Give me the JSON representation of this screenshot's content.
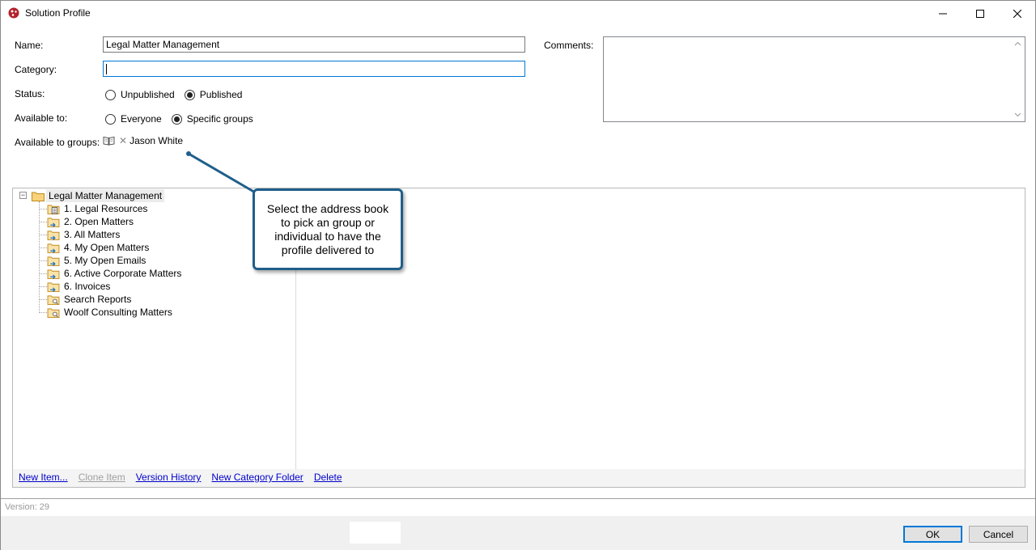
{
  "window": {
    "title": "Solution Profile",
    "icons": [
      "app-logo-icon",
      "minimize-icon",
      "maximize-icon",
      "close-icon"
    ]
  },
  "form": {
    "name_label": "Name:",
    "name_value": "Legal Matter Management",
    "category_label": "Category:",
    "category_value": "",
    "status_label": "Status:",
    "status_options": [
      {
        "label": "Unpublished",
        "checked": false
      },
      {
        "label": "Published",
        "checked": true
      }
    ],
    "available_label": "Available to:",
    "available_options": [
      {
        "label": "Everyone",
        "checked": false
      },
      {
        "label": "Specific groups",
        "checked": true
      }
    ],
    "groups_label": "Available to groups:",
    "group_name": "Jason White",
    "comments_label": "Comments:",
    "comments_value": ""
  },
  "tree": {
    "root": "Legal Matter Management",
    "items": [
      "1. Legal Resources",
      "2. Open Matters",
      "3. All Matters",
      "4. My Open Matters",
      "5. My Open Emails",
      "6. Active Corporate Matters",
      "6. Invoices",
      "Search Reports",
      "Woolf Consulting Matters"
    ]
  },
  "actions": {
    "new_item": "New Item...",
    "clone_item": "Clone Item",
    "version_history": "Version History",
    "new_category_folder": "New Category Folder",
    "delete": "Delete"
  },
  "footer": {
    "version": "Version: 29",
    "ok": "OK",
    "cancel": "Cancel"
  },
  "callout": {
    "text": "Select the address book to pick an group or individual to have the profile delivered to"
  },
  "colors": {
    "accent": "#0078d7",
    "callout_border": "#1f5f8b",
    "link": "#0000cc",
    "folder": "#e8b04a"
  }
}
